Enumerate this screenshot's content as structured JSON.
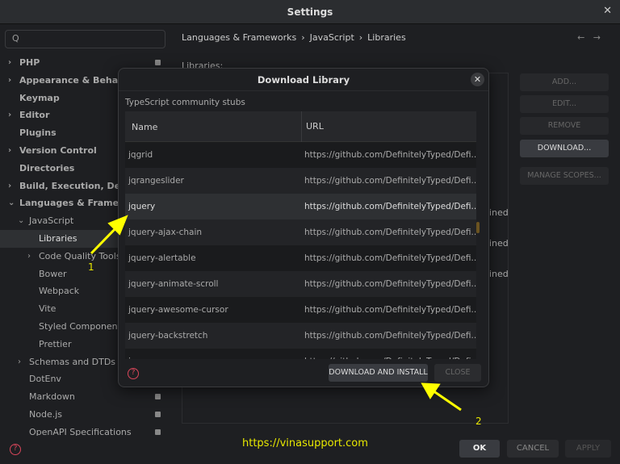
{
  "window": {
    "title": "Settings",
    "close": "✕"
  },
  "search": {
    "icon": "Q"
  },
  "sidebar": {
    "items": [
      {
        "label": "PHP",
        "chev": "›",
        "badge": true
      },
      {
        "label": "Appearance & Behavior",
        "chev": "›"
      },
      {
        "label": "Keymap"
      },
      {
        "label": "Editor",
        "chev": "›"
      },
      {
        "label": "Plugins"
      },
      {
        "label": "Version Control",
        "chev": "›"
      },
      {
        "label": "Directories"
      },
      {
        "label": "Build, Execution, Deployment",
        "chev": "›"
      },
      {
        "label": "Languages & Frameworks",
        "chev": "⌄"
      },
      {
        "label": "JavaScript",
        "chev": "⌄"
      },
      {
        "label": "Libraries"
      },
      {
        "label": "Code Quality Tools",
        "chev": "›"
      },
      {
        "label": "Bower"
      },
      {
        "label": "Webpack"
      },
      {
        "label": "Vite"
      },
      {
        "label": "Styled Components"
      },
      {
        "label": "Prettier"
      },
      {
        "label": "Schemas and DTDs",
        "chev": "›"
      },
      {
        "label": "DotEnv"
      },
      {
        "label": "Markdown",
        "badge": true
      },
      {
        "label": "Node.js",
        "badge": true
      },
      {
        "label": "OpenAPI Specifications",
        "badge": true
      }
    ]
  },
  "breadcrumb": [
    "Languages & Frameworks",
    "›",
    "JavaScript",
    "›",
    "Libraries"
  ],
  "nav": {
    "back": "←",
    "forward": "→"
  },
  "main": {
    "libraries_label": "Libraries:",
    "behind": [
      "t",
      "ined",
      "ined",
      "ined"
    ]
  },
  "right_buttons": [
    "ADD...",
    "EDIT...",
    "REMOVE",
    "DOWNLOAD...",
    "MANAGE SCOPES..."
  ],
  "dialog": {
    "title": "Download Library",
    "close": "✕",
    "subtitle": "TypeScript community stubs",
    "columns": [
      "Name",
      "URL"
    ],
    "rows": [
      {
        "name": "jqgrid",
        "url": "https://github.com/DefinitelyTyped/Defi..."
      },
      {
        "name": "jqrangeslider",
        "url": "https://github.com/DefinitelyTyped/Defi..."
      },
      {
        "name": "jquery",
        "url": "https://github.com/DefinitelyTyped/Defi..."
      },
      {
        "name": "jquery-ajax-chain",
        "url": "https://github.com/DefinitelyTyped/Defi..."
      },
      {
        "name": "jquery-alertable",
        "url": "https://github.com/DefinitelyTyped/Defi..."
      },
      {
        "name": "jquery-animate-scroll",
        "url": "https://github.com/DefinitelyTyped/Defi..."
      },
      {
        "name": "jquery-awesome-cursor",
        "url": "https://github.com/DefinitelyTyped/Defi..."
      },
      {
        "name": "jquery-backstretch",
        "url": "https://github.com/DefinitelyTyped/Defi..."
      },
      {
        "name": "jquery-...",
        "url": "https://github.com/DefinitelyTyped/Defi..."
      }
    ],
    "selected_index": 2,
    "download_install": "DOWNLOAD AND INSTALL",
    "close_btn": "CLOSE",
    "help": "?"
  },
  "footer": {
    "ok": "OK",
    "cancel": "CANCEL",
    "apply": "APPLY",
    "help": "?"
  },
  "watermark": "https://vinasupport.com",
  "annotations": [
    "1",
    "2"
  ],
  "colors": {
    "arrow": "#ffff00",
    "help": "#d9465a"
  }
}
